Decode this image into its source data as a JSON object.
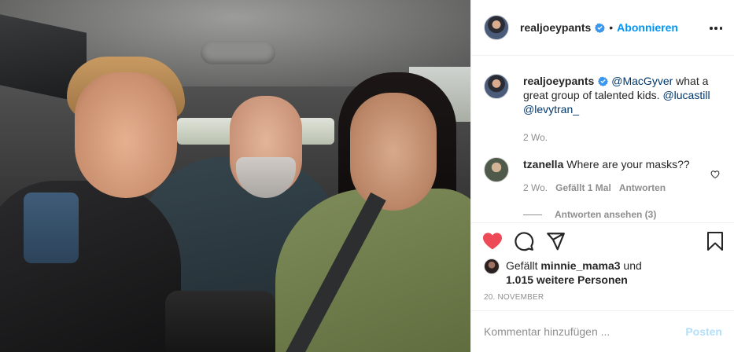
{
  "post": {
    "photo_alt": "Selfie of three people in a car"
  },
  "header": {
    "username": "realjoeypants",
    "separator": "•",
    "follow_label": "Abonnieren"
  },
  "caption": {
    "username": "realjoeypants",
    "mention1": "@MacGyver",
    "text1": " what a great group of talented kids.",
    "mention2": "@lucastill",
    "mention3": "@levytran_",
    "time": "2 Wo."
  },
  "comment": {
    "username": "tzanella",
    "text": "Where are your masks??",
    "time": "2 Wo.",
    "likes": "Gefällt 1 Mal",
    "reply_label": "Antworten",
    "view_replies": "Antworten ansehen (3)"
  },
  "likes_line": {
    "prefix": "Gefällt ",
    "user": "minnie_mama3",
    "middle": " und",
    "others": "1.015 weitere Personen"
  },
  "date": "20. NOVEMBER",
  "composer": {
    "placeholder": "Kommentar hinzufügen ...",
    "post_label": "Posten"
  },
  "colors": {
    "accent": "#0095f6",
    "like_red": "#ed4956",
    "verified_blue": "#3897f0",
    "post_disabled": "#b2dffc"
  },
  "icons": [
    "verified-icon",
    "more-options-icon",
    "heart-icon",
    "comment-icon",
    "share-icon",
    "bookmark-icon"
  ]
}
